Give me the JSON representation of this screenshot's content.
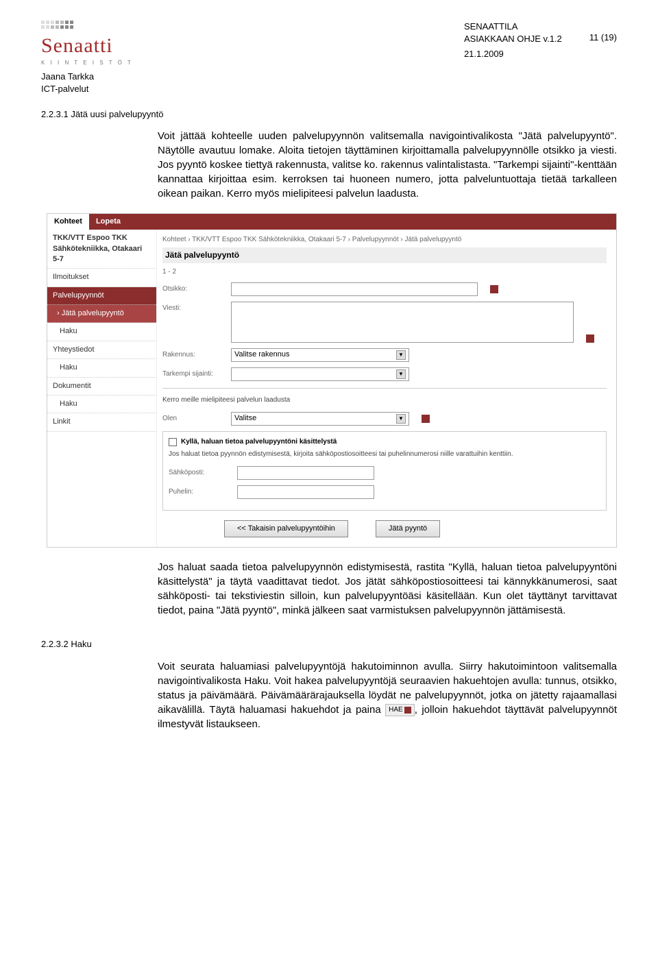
{
  "header": {
    "logo_name": "Senaatti",
    "logo_sub": "K I I N T E I S T Ö T",
    "doc_title": "SENAATTILA",
    "doc_subtitle": "ASIAKKAAN OHJE v.1.2",
    "page_counter": "11 (19)",
    "author": "Jaana Tarkka",
    "dept": "ICT-palvelut",
    "date": "21.1.2009"
  },
  "section1": {
    "num": "2.2.3.1 Jätä uusi palvelupyyntö",
    "p1": "Voit jättää kohteelle uuden palvelupyynnön valitsemalla navigointivalikosta \"Jätä palvelupyyntö\". Näytölle avautuu lomake. Aloita tietojen täyttäminen kirjoittamalla palvelupyynnölle otsikko ja viesti. Jos pyyntö koskee tiettyä rakennusta, valitse ko. rakennus valintalistasta. \"Tarkempi sijainti\"-kenttään kannattaa kirjoittaa esim. kerroksen tai huoneen numero, jotta palveluntuottaja tietää tarkalleen oikean paikan. Kerro myös mielipiteesi palvelun laadusta.",
    "p2": "Jos haluat saada tietoa palvelupyynnön edistymisestä, rastita \"Kyllä, haluan tietoa palvelupyyntöni käsittelystä\" ja täytä vaadittavat tiedot. Jos jätät sähköpostiosoitteesi tai kännykkänumerosi, saat sähköposti- tai tekstiviestin silloin, kun palvelupyyntöäsi käsitellään. Kun olet täyttänyt tarvittavat tiedot, paina \"Jätä pyyntö\", minkä jälkeen saat varmistuksen palvelupyynnön jättämisestä."
  },
  "section2": {
    "num": "2.2.3.2 Haku",
    "p1_a": "Voit seurata haluamiasi palvelupyyntöjä hakutoiminnon avulla. Siirry hakutoimintoon valitsemalla navigointivalikosta Haku. Voit hakea palvelupyyntöjä seuraavien hakuehtojen avulla: tunnus, otsikko, status ja päivämäärä. Päivämäärärajauksella löydät ne palvelupyynnöt, jotka on jätetty rajaamallasi aikavälillä. Täytä haluamasi hakuehdot ja paina ",
    "p1_b": ", jolloin hakuehdot täyttävät palvelupyynnöt ilmestyvät listaukseen.",
    "hae_label": "HAE"
  },
  "screenshot": {
    "tabs": {
      "active": "Kohteet",
      "other": "Lopeta"
    },
    "side": {
      "head1": "TKK/VTT Espoo TKK",
      "head2": "Sähkötekniikka, Otakaari 5-7",
      "items": [
        "Ilmoitukset",
        "Palvelupyynnöt",
        "Jätä palvelupyyntö",
        "Haku",
        "Yhteystiedot",
        "Haku",
        "Dokumentit",
        "Haku",
        "Linkit"
      ]
    },
    "content": {
      "crumb": "Kohteet › TKK/VTT Espoo TKK Sähkötekniikka, Otakaari 5-7 › Palvelupyynnöt › Jätä palvelupyyntö",
      "title": "Jätä palvelupyyntö",
      "count": "1 - 2",
      "labels": {
        "otsikko": "Otsikko:",
        "viesti": "Viesti:",
        "rakennus": "Rakennus:",
        "sijainti": "Tarkempi sijainti:",
        "laatu_intro": "Kerro meille mielipiteesi palvelun laadusta",
        "olen": "Olen",
        "check": "Kyllä, haluan tietoa palvelupyyntöni käsittelystä",
        "note": "Jos haluat tietoa pyynnön edistymisestä, kirjoita sähköpostiosoitteesi tai puhelinnumerosi niille varattuihin kenttiin.",
        "sahkoposti": "Sähköposti:",
        "puhelin": "Puhelin:"
      },
      "select_rakennus": "Valitse rakennus",
      "select_olen": "Valitse",
      "btn_back": "<< Takaisin palvelupyyntöihin",
      "btn_submit": "Jätä pyyntö"
    }
  }
}
